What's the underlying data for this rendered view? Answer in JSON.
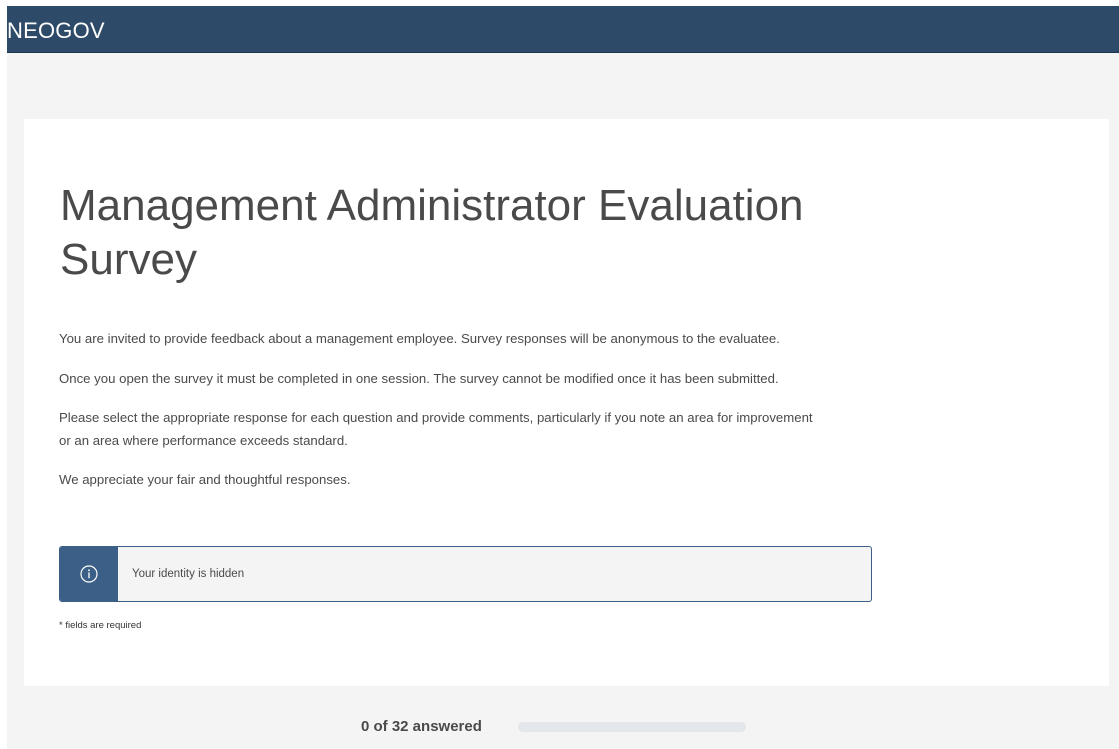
{
  "header": {
    "brand": "NEOGOV"
  },
  "survey": {
    "title": "Management Administrator Evaluation Survey",
    "paragraphs": [
      "You are invited to provide feedback about a management employee.  Survey responses will be anonymous to the evaluatee.",
      "Once you open the survey it must be completed in one session.  The survey cannot be modified once it has been submitted.",
      "Please select the appropriate response for each question and provide comments, particularly if you note an area for improvement or an area where performance exceeds standard.",
      "We appreciate your fair and thoughtful responses."
    ],
    "identity_notice": "Your identity is hidden",
    "required_note": "* fields are required"
  },
  "progress": {
    "label": "0 of 32 answered",
    "answered": 0,
    "total": 32
  },
  "icons": {
    "info": "info-circle-icon"
  },
  "colors": {
    "header_bg": "#2d4a68",
    "accent": "#3b5f86",
    "page_bg": "#f4f4f4",
    "text": "#4a4a4a"
  }
}
